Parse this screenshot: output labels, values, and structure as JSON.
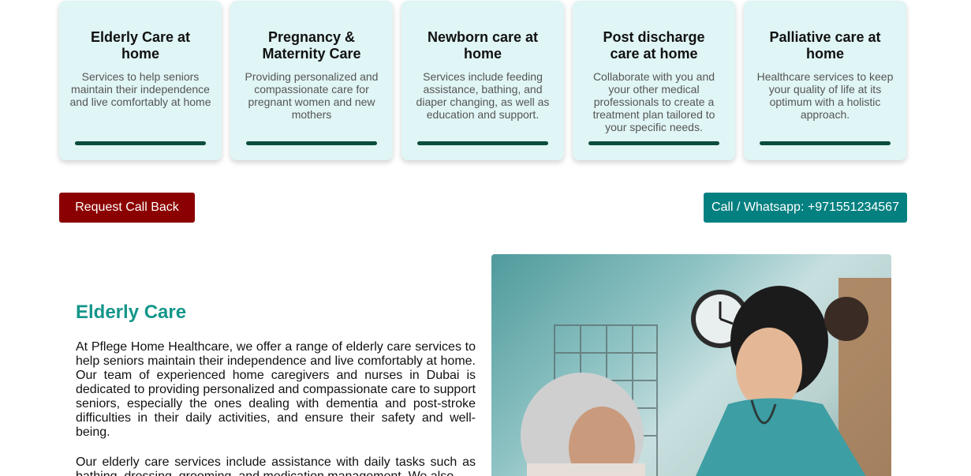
{
  "cards": [
    {
      "title": "Elderly Care at home",
      "description": "Services to help seniors maintain their independence and live comfortably at home"
    },
    {
      "title": "Pregnancy & Maternity Care",
      "description": "Providing personalized and compassionate care for pregnant women and new mothers"
    },
    {
      "title": "Newborn care at home",
      "description": "Services include feeding assistance, bathing, and diaper changing, as well as education and support."
    },
    {
      "title": "Post discharge care at home",
      "description": "Collaborate with you and your other medical professionals to create a treatment plan tailored to your specific needs."
    },
    {
      "title": "Palliative care at home",
      "description": "Healthcare services to keep your quality of life at its optimum with a holistic approach."
    }
  ],
  "buttons": {
    "callback": "Request Call Back",
    "whatsapp": "Call / Whatsapp: +971551234567"
  },
  "section": {
    "title": "Elderly Care",
    "paragraph1": "At Pflege Home Healthcare, we offer a range of elderly care services to help seniors maintain their independence and live comfortably at home. Our team of experienced home caregivers and nurses in Dubai is dedicated to providing personalized and compassionate care to support seniors, especially the ones dealing with dementia and post-stroke difficulties in their daily activities, and ensure their safety and well-being.",
    "paragraph2": "Our elderly care services include assistance with daily tasks such as bathing, dressing, grooming, and medication management. We also"
  },
  "colors": {
    "card_bg": "#e0f5f5",
    "card_bar": "#0b4d3c",
    "callback_btn": "#8b0000",
    "whatsapp_btn": "#058080",
    "section_title": "#14968a"
  }
}
